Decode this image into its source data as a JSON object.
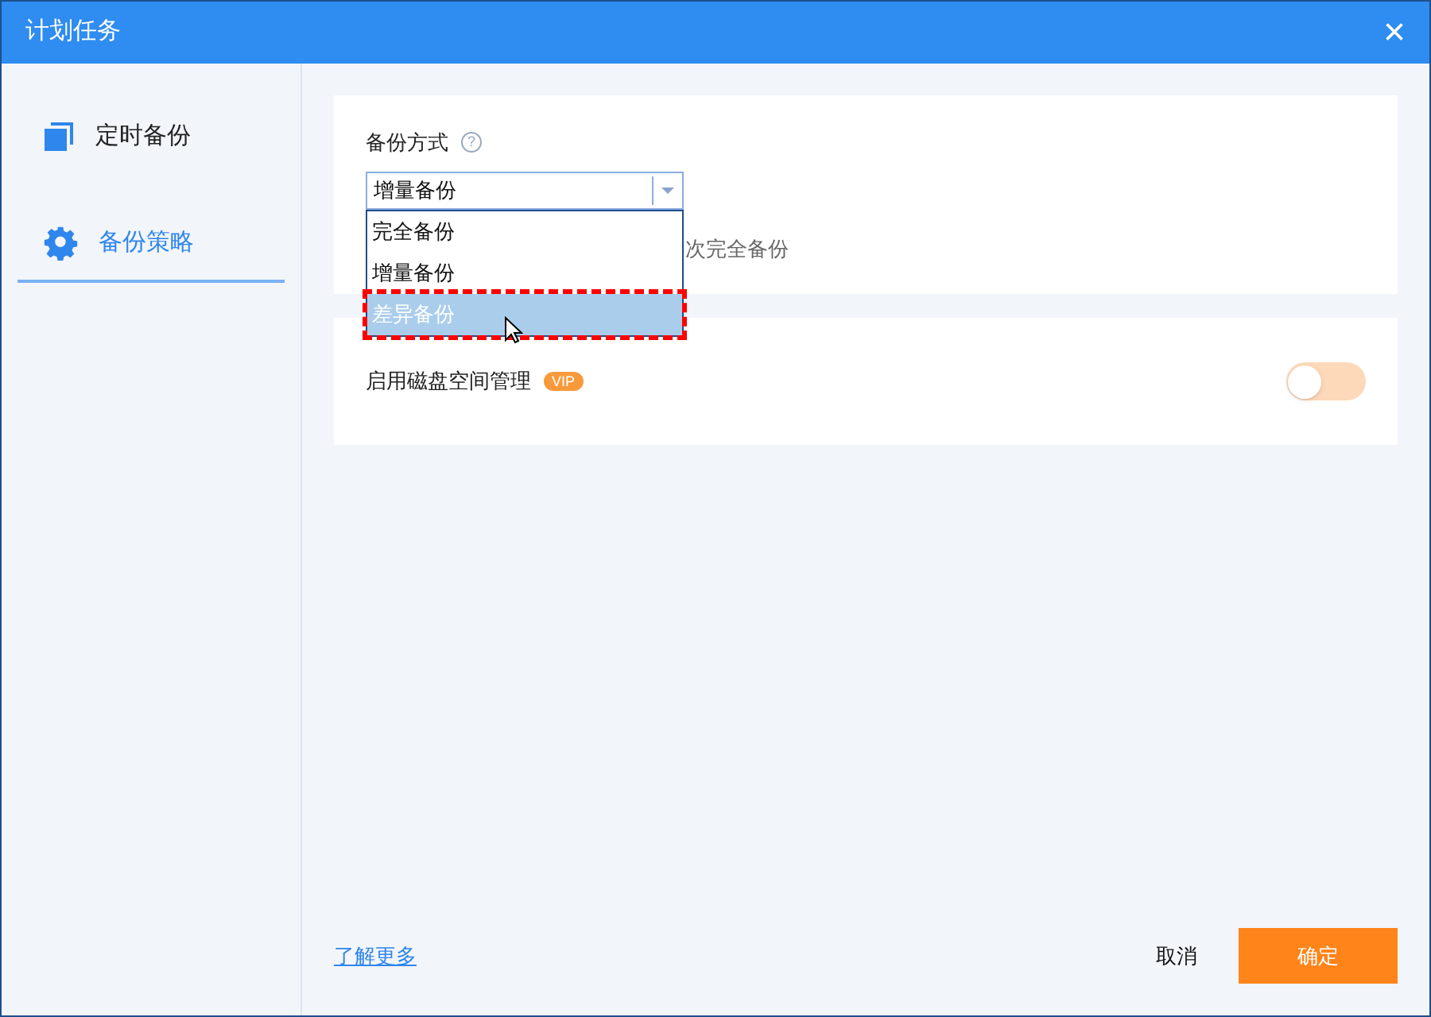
{
  "window": {
    "title": "计划任务",
    "close": "×"
  },
  "sidebar": {
    "items": [
      {
        "label": "定时备份",
        "kind": "schedule",
        "selected": false
      },
      {
        "label": "备份策略",
        "kind": "settings",
        "selected": true
      }
    ]
  },
  "backup_method": {
    "label": "备份方式",
    "help": "?",
    "value": "增量备份",
    "expanded": true,
    "options": [
      {
        "label": "完全备份",
        "highlighted": false
      },
      {
        "label": "增量备份",
        "highlighted": false
      },
      {
        "label": "差异备份",
        "highlighted": true
      }
    ],
    "hint": "次完全备份"
  },
  "disk_space": {
    "label": "启用磁盘空间管理",
    "badge": "VIP",
    "on": false
  },
  "footer": {
    "link": "了解更多",
    "cancel": "取消",
    "ok": "确定"
  }
}
